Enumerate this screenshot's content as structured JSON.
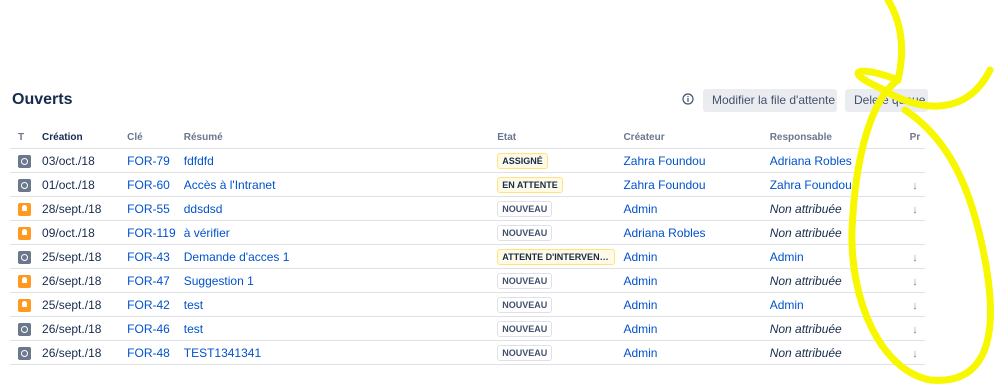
{
  "page": {
    "title": "Ouverts",
    "actions": {
      "info_icon": "info-icon",
      "edit_label": "Modifier la file d'attente",
      "delete_label": "Delete queue"
    }
  },
  "table": {
    "columns": {
      "type": "T",
      "created": "Création",
      "key": "Clé",
      "summary": "Résumé",
      "status": "Etat",
      "reporter": "Créateur",
      "assignee": "Responsable",
      "priority": "Pr"
    },
    "rows": [
      {
        "type_color": "#6b778c",
        "created": "03/oct./18",
        "key": "FOR-79",
        "summary": "fdfdfd",
        "status": "ASSIGNÉ",
        "status_style": "yellow",
        "reporter": "Zahra Foundou",
        "assignee": "Adriana Robles",
        "assignee_unassigned": false,
        "priority": ""
      },
      {
        "type_color": "#6b778c",
        "created": "01/oct./18",
        "key": "FOR-60",
        "summary": "Accès à l'Intranet",
        "status": "EN ATTENTE",
        "status_style": "yellow",
        "reporter": "Zahra Foundou",
        "assignee": "Zahra Foundou",
        "assignee_unassigned": false,
        "priority": "↓"
      },
      {
        "type_color": "#ff991f",
        "created": "28/sept./18",
        "key": "FOR-55",
        "summary": "ddsdsd",
        "status": "NOUVEAU",
        "status_style": "grey",
        "reporter": "Admin",
        "assignee": "Non attribuée",
        "assignee_unassigned": true,
        "priority": "↓"
      },
      {
        "type_color": "#ff991f",
        "created": "09/oct./18",
        "key": "FOR-119",
        "summary": "à vérifier",
        "status": "NOUVEAU",
        "status_style": "grey",
        "reporter": "Adriana Robles",
        "assignee": "Non attribuée",
        "assignee_unassigned": true,
        "priority": ""
      },
      {
        "type_color": "#6b778c",
        "created": "25/sept./18",
        "key": "FOR-43",
        "summary": "Demande d'acces 1",
        "status": "ATTENTE D'INTERVENT...",
        "status_style": "yellow",
        "reporter": "Admin",
        "assignee": "Admin",
        "assignee_unassigned": false,
        "priority": "↓"
      },
      {
        "type_color": "#ff991f",
        "created": "26/sept./18",
        "key": "FOR-47",
        "summary": "Suggestion 1",
        "status": "NOUVEAU",
        "status_style": "grey",
        "reporter": "Admin",
        "assignee": "Non attribuée",
        "assignee_unassigned": true,
        "priority": "↓"
      },
      {
        "type_color": "#ff991f",
        "created": "25/sept./18",
        "key": "FOR-42",
        "summary": "test",
        "status": "NOUVEAU",
        "status_style": "grey",
        "reporter": "Admin",
        "assignee": "Admin",
        "assignee_unassigned": false,
        "priority": "↓"
      },
      {
        "type_color": "#6b778c",
        "created": "26/sept./18",
        "key": "FOR-46",
        "summary": "test",
        "status": "NOUVEAU",
        "status_style": "grey",
        "reporter": "Admin",
        "assignee": "Non attribuée",
        "assignee_unassigned": true,
        "priority": "↓"
      },
      {
        "type_color": "#6b778c",
        "created": "26/sept./18",
        "key": "FOR-48",
        "summary": "TEST1341341",
        "status": "NOUVEAU",
        "status_style": "grey",
        "reporter": "Admin",
        "assignee": "Non attribuée",
        "assignee_unassigned": true,
        "priority": "↓"
      }
    ]
  },
  "colors": {
    "link": "#0052cc",
    "annotation": "#f7f700"
  }
}
